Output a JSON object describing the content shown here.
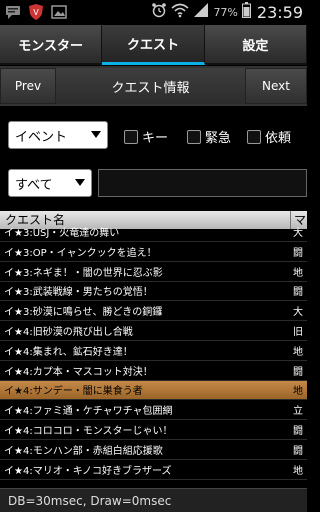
{
  "status_bar": {
    "battery_percent": "77%",
    "time": "23:59",
    "icons": [
      "chat-icon",
      "shield-icon",
      "image-icon",
      "alarm-icon",
      "wifi-icon",
      "signal-icon",
      "battery-icon"
    ]
  },
  "tabs": [
    {
      "label": "モンスター",
      "active": false
    },
    {
      "label": "クエスト",
      "active": true
    },
    {
      "label": "設定",
      "active": false
    }
  ],
  "title_bar": {
    "prev_label": "Prev",
    "title": "クエスト情報",
    "next_label": "Next"
  },
  "filters": {
    "category_select": "イベント",
    "checkboxes": [
      {
        "label": "キー",
        "checked": false
      },
      {
        "label": "緊急",
        "checked": false
      },
      {
        "label": "依頼",
        "checked": false
      }
    ],
    "scope_select": "すべて",
    "search_value": ""
  },
  "table": {
    "columns": [
      "クエスト名",
      "マ"
    ],
    "rows": [
      {
        "name": "イ★3:USJ・火竜達の舞い",
        "map": "大"
      },
      {
        "name": "イ★3:OP・イャンクックを追え！",
        "map": "闘"
      },
      {
        "name": "イ★3:ネギま！・闇の世界に忍ぶ影",
        "map": "地"
      },
      {
        "name": "イ★3:武装戦線・男たちの覚悟！",
        "map": "闘"
      },
      {
        "name": "イ★3:砂漠に鳴らせ、勝どきの銅鑼",
        "map": "大"
      },
      {
        "name": "イ★4:旧砂漠の飛び出し合戦",
        "map": "旧"
      },
      {
        "name": "イ★4:集まれ、鉱石好き達！",
        "map": "地"
      },
      {
        "name": "イ★4:カプ本・マスコット対決！",
        "map": "闘"
      },
      {
        "name": "イ★4:サンデー・闇に巣食う者",
        "map": "地",
        "selected": true
      },
      {
        "name": "イ★4:ファミ通・ケチャワチャ包囲網",
        "map": "立"
      },
      {
        "name": "イ★4:コロコロ・モンスターじゃい！",
        "map": "闘"
      },
      {
        "name": "イ★4:モンハン部・赤組白組応援歌",
        "map": "闘"
      },
      {
        "name": "イ★4:マリオ・キノコ好きブラザーズ",
        "map": "地"
      }
    ]
  },
  "footer": {
    "text": "DB=30msec, Draw=0msec"
  },
  "colors": {
    "accent": "#0ab0e6",
    "selected_row": "#b07838"
  }
}
